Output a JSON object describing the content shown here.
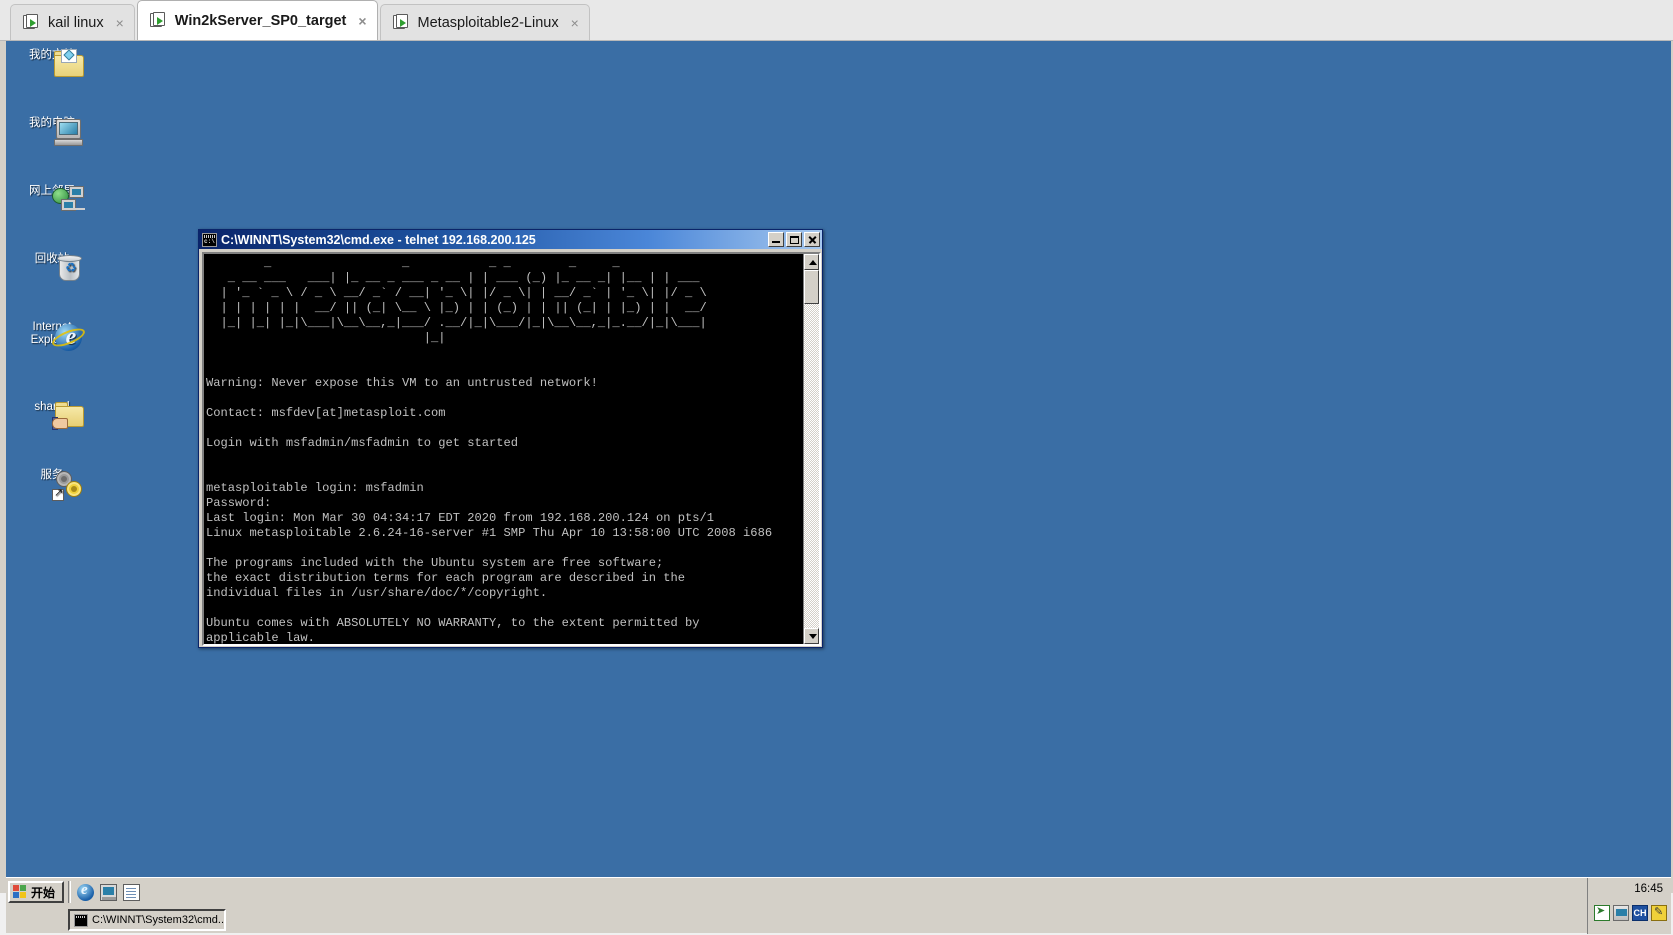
{
  "app": {
    "tabs": [
      {
        "label": "kail linux",
        "active": false,
        "close": "×",
        "icon": "vm-tab-icon"
      },
      {
        "label": "Win2kServer_SP0_target",
        "active": true,
        "close": "×",
        "icon": "vm-tab-icon"
      },
      {
        "label": "Metasploitable2-Linux",
        "active": false,
        "close": "×",
        "icon": "vm-tab-icon"
      }
    ]
  },
  "desktop": {
    "background_color": "#3a6ea5",
    "icons": [
      {
        "label": "我的档文",
        "name": "my-documents",
        "display": "我的文档"
      },
      {
        "label": "我的电脑",
        "name": "my-computer"
      },
      {
        "label": "网上邻居",
        "name": "network-neighborhood"
      },
      {
        "label": "回收站",
        "name": "recycle-bin"
      },
      {
        "label": "Internet Explorer",
        "name": "internet-explorer"
      },
      {
        "label": "shared",
        "name": "shared-folder"
      },
      {
        "label": "服务",
        "name": "services"
      }
    ]
  },
  "cmd_window": {
    "title": "C:\\WINNT\\System32\\cmd.exe - telnet 192.168.200.125",
    "buttons": {
      "minimize": "_",
      "maximize": "□",
      "close": "×"
    },
    "terminal_text": "        _                  _           _ _        _     _\n   _ __ ___   ___| |_ __ _ ___ _ __ | | ___ (_) |_ __ _| |__ | | ___\n  | '_ ` _ \\ / _ \\ __/ _` / __| '_ \\| |/ _ \\| | __/ _` | '_ \\| |/ _ \\\n  | | | | | |  __/ || (_| \\__ \\ |_) | | (_) | | || (_| | |_) | |  __/\n  |_| |_| |_|\\___|\\__\\__,_|___/ .__/|_|\\___/|_|\\__\\__,_|_.__/|_|\\___|\n                              |_|\n\n\nWarning: Never expose this VM to an untrusted network!\n\nContact: msfdev[at]metasploit.com\n\nLogin with msfadmin/msfadmin to get started\n\n\nmetasploitable login: msfadmin\nPassword:\nLast login: Mon Mar 30 04:34:17 EDT 2020 from 192.168.200.124 on pts/1\nLinux metasploitable 2.6.24-16-server #1 SMP Thu Apr 10 13:58:00 UTC 2008 i686\n\nThe programs included with the Ubuntu system are free software;\nthe exact distribution terms for each program are described in the\nindividual files in /usr/share/doc/*/copyright.\n\nUbuntu comes with ABSOLUTELY NO WARRANTY, to the extent permitted by\napplicable law."
  },
  "taskbar": {
    "start_label": "开始",
    "quick_launch": [
      "internet-explorer-icon",
      "show-desktop-icon",
      "notepad-icon"
    ],
    "task_items": [
      {
        "label": "C:\\WINNT\\System32\\cmd...",
        "icon": "cmd-icon"
      }
    ],
    "clock": "16:45",
    "tray_icons": [
      "network-icon",
      "display-icon",
      "ime-ch-icon",
      "pen-icon"
    ],
    "ime_label": "CH"
  }
}
